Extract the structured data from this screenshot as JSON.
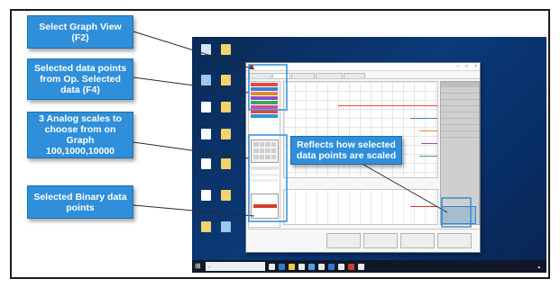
{
  "callouts": {
    "graph_view": "Select Graph View\n(F2)",
    "data_points": "Selected data points\nfrom Op. Selected\ndata (F4)",
    "analog_scales": "3 Analog scales to\nchoose from on Graph\n100,1000,10000",
    "binary_points": "Selected Binary data\npoints",
    "reflects": "Reflects how selected\ndata points are scaled"
  },
  "colors": {
    "callout_fill": "#2f8fdb",
    "desktop": "#0b3a78",
    "binary_red": "#d63b2f",
    "selection_blue": "#2b86d6"
  },
  "icons": {
    "start": "windows-logo-icon",
    "search": "search-icon"
  }
}
